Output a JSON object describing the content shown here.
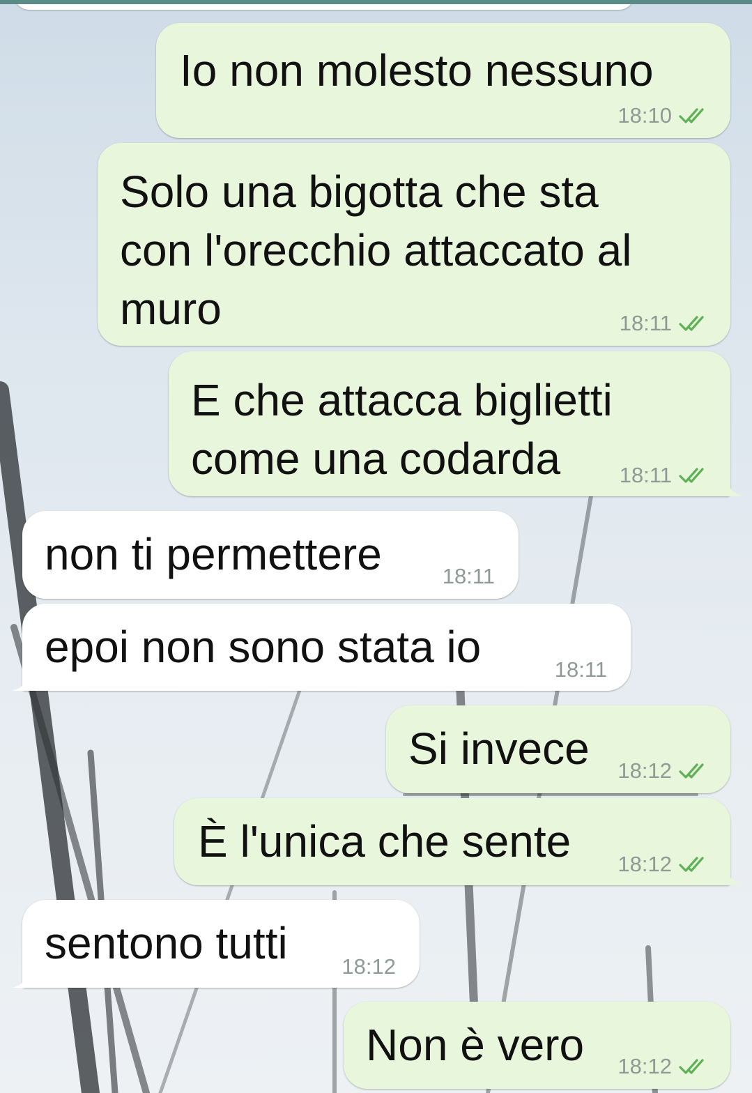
{
  "colors": {
    "outgoing_bubble": "#e8f6dc",
    "incoming_bubble": "#ffffff",
    "read_ticks": "#5fb157",
    "timestamp": "#8f9a95"
  },
  "icons": {
    "read_receipt": "double-check-icon"
  },
  "messages": [
    {
      "direction": "outgoing",
      "text": "Io non molesto nessuno",
      "time": "18:10",
      "status": "read"
    },
    {
      "direction": "outgoing",
      "text": "Solo una bigotta che sta\ncon l'orecchio attaccato al\nmuro",
      "time": "18:11",
      "status": "read"
    },
    {
      "direction": "outgoing",
      "text": "E che attacca biglietti\ncome una codarda",
      "time": "18:11",
      "status": "read"
    },
    {
      "direction": "incoming",
      "text": "non ti permettere",
      "time": "18:11"
    },
    {
      "direction": "incoming",
      "text": "epoi non sono stata io",
      "time": "18:11"
    },
    {
      "direction": "outgoing",
      "text": "Si invece",
      "time": "18:12",
      "status": "read"
    },
    {
      "direction": "outgoing",
      "text": "È l'unica che sente",
      "time": "18:12",
      "status": "read"
    },
    {
      "direction": "incoming",
      "text": "sentono tutti",
      "time": "18:12"
    },
    {
      "direction": "outgoing",
      "text": "Non è vero",
      "time": "18:12",
      "status": "read"
    }
  ]
}
